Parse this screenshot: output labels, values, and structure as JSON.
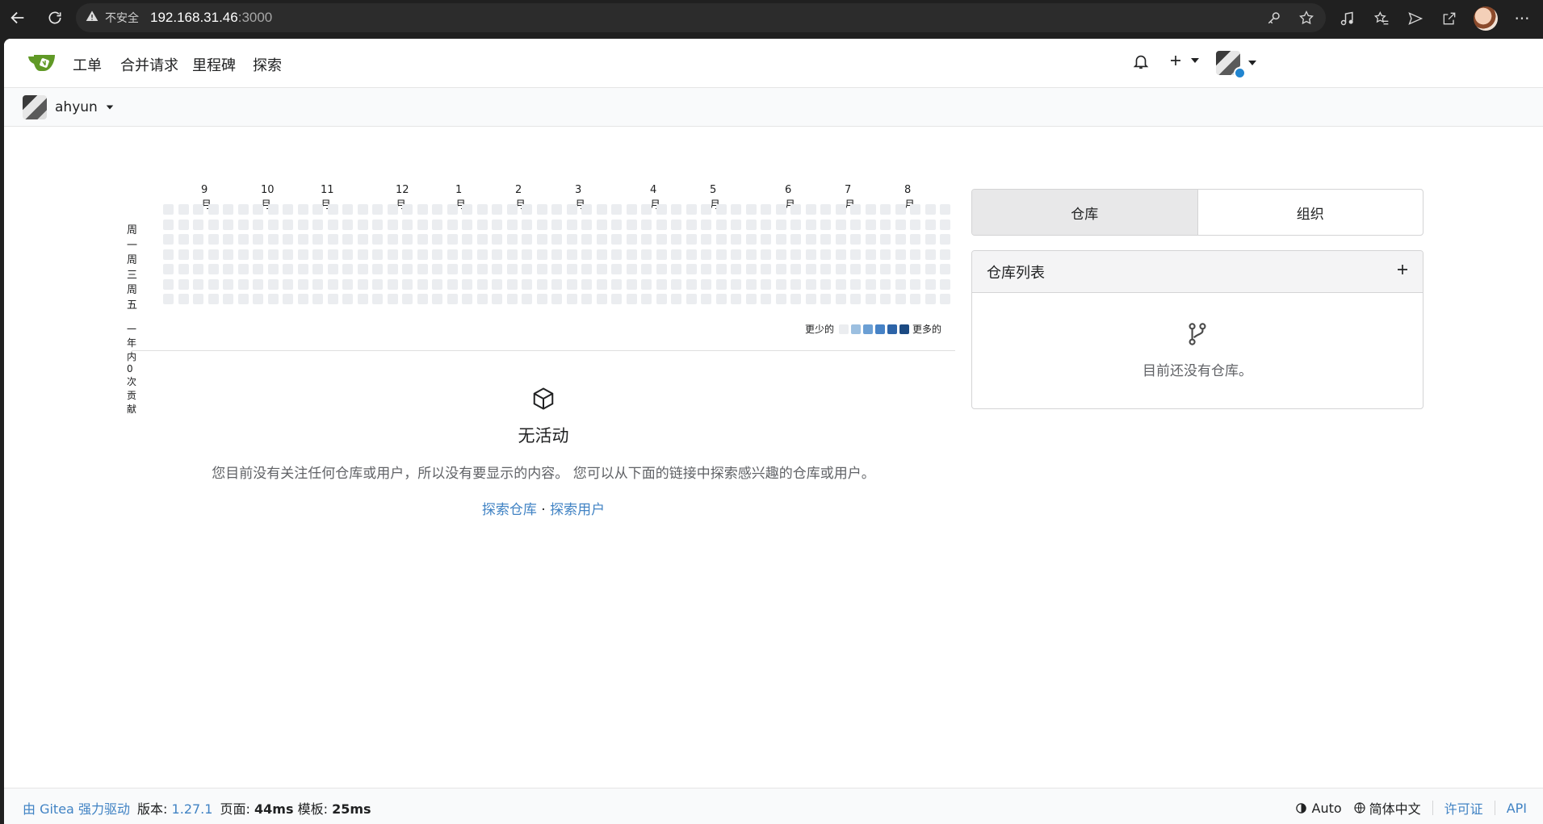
{
  "browser": {
    "insecure_label": "不安全",
    "host": "192.168.31.46",
    "port": ":3000"
  },
  "nav": {
    "items": [
      "工单",
      "合并请求",
      "里程碑",
      "探索"
    ]
  },
  "context": {
    "username": "ahyun"
  },
  "heatmap": {
    "months": [
      "9月",
      "10月",
      "11月",
      "12月",
      "1月",
      "2月",
      "3月",
      "4月",
      "5月",
      "6月",
      "7月",
      "8月"
    ],
    "days": [
      "周一",
      "周三",
      "周五"
    ],
    "total_label": "一年内 0 次贡献",
    "less_label": "更少的",
    "more_label": "更多的",
    "colors": [
      "#ebedf0",
      "#9cbfe0",
      "#6b9fd4",
      "#4682c6",
      "#2d64a8",
      "#1c4a82"
    ],
    "contributions": 0
  },
  "feed": {
    "title": "无活动",
    "description": "您目前没有关注任何仓库或用户，所以没有要显示的内容。 您可以从下面的链接中探索感兴趣的仓库或用户。",
    "explore_repos": "探索仓库",
    "separator": "·",
    "explore_users": "探索用户"
  },
  "right": {
    "tab_repos": "仓库",
    "tab_orgs": "组织",
    "repo_list_title": "仓库列表",
    "add_symbol": "+",
    "no_repos": "目前还没有仓库。"
  },
  "footer": {
    "powered": "由 Gitea 强力驱动",
    "version_label": "版本:",
    "version": "1.27.1",
    "page_label": "页面:",
    "page_time": "44ms",
    "template_label": "模板:",
    "template_time": "25ms",
    "theme": "Auto",
    "language": "简体中文",
    "license": "许可证",
    "api": "API"
  },
  "colors": {
    "link": "#4183c4",
    "gitea_green": "#609926"
  }
}
